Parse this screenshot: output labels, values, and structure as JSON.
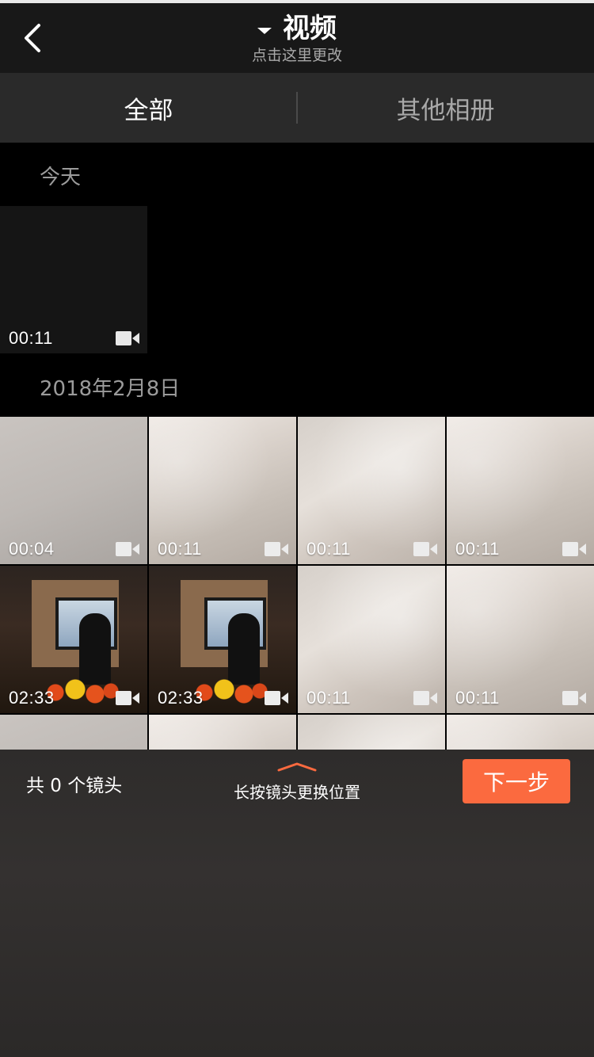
{
  "header": {
    "title": "视频",
    "subtitle": "点击这里更改"
  },
  "tabs": [
    {
      "label": "全部",
      "active": true
    },
    {
      "label": "其他相册",
      "active": false
    }
  ],
  "sections": [
    {
      "label": "今天",
      "items": [
        {
          "duration": "00:11"
        }
      ]
    },
    {
      "label": "2018年2月8日",
      "items": [
        {
          "duration": "00:04"
        },
        {
          "duration": "00:11"
        },
        {
          "duration": "00:11"
        },
        {
          "duration": "00:11"
        },
        {
          "duration": "02:33"
        },
        {
          "duration": "02:33"
        },
        {
          "duration": "00:11"
        },
        {
          "duration": "00:11"
        }
      ]
    }
  ],
  "bottom": {
    "count_text": "共 0 个镜头",
    "hint": "长按镜头更换位置",
    "next_label": "下一步"
  },
  "colors": {
    "accent": "#fb6a3f",
    "header_bg": "#181818",
    "tabs_bg": "#2a2a2a"
  },
  "icons": {
    "back": "chevron-left-icon",
    "dropdown": "caret-down-icon",
    "video": "video-camera-icon",
    "handle": "chevron-up-icon"
  }
}
